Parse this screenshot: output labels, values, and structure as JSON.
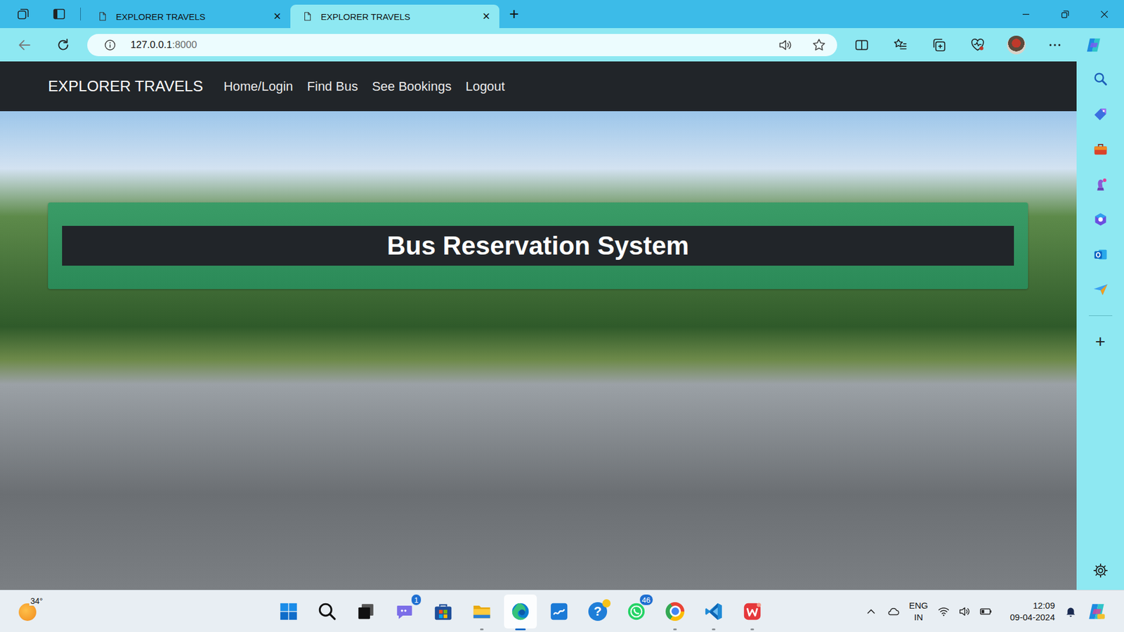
{
  "browser": {
    "tabs": [
      {
        "label": "EXPLORER TRAVELS",
        "close": "×",
        "selected": false
      },
      {
        "label": "EXPLORER TRAVELS",
        "close": "×",
        "selected": true
      }
    ],
    "new_tab": "+",
    "address": {
      "host": "127.0.0.1",
      "port": ":8000"
    }
  },
  "page": {
    "brand": "EXPLORER TRAVELS",
    "nav": [
      "Home/Login",
      "Find Bus",
      "See Bookings",
      "Logout"
    ],
    "hero": {
      "title": "Bus Reservation System"
    }
  },
  "sidebar": {
    "add": "+"
  },
  "taskbar": {
    "weather": "34°",
    "apps": [
      {
        "kind": "start",
        "running": false,
        "selected": false
      },
      {
        "kind": "search",
        "running": false,
        "selected": false
      },
      {
        "kind": "taskview",
        "running": false,
        "selected": false
      },
      {
        "kind": "chat",
        "badge": "1",
        "running": false,
        "selected": false
      },
      {
        "kind": "store",
        "running": false,
        "selected": false
      },
      {
        "kind": "explorer",
        "running": true,
        "selected": false
      },
      {
        "kind": "edge",
        "running": true,
        "selected": true
      },
      {
        "kind": "hp",
        "running": false,
        "selected": false
      },
      {
        "kind": "help",
        "glyph": "?",
        "running": false,
        "selected": false
      },
      {
        "kind": "whatsapp",
        "badge": "46",
        "running": false,
        "selected": false
      },
      {
        "kind": "chrome",
        "running": true,
        "selected": false
      },
      {
        "kind": "vscode",
        "running": true,
        "selected": false
      },
      {
        "kind": "wps",
        "running": true,
        "selected": false
      }
    ],
    "tray": {
      "language": "ENG",
      "region": "IN",
      "time": "12:09",
      "date": "09-04-2024"
    }
  }
}
